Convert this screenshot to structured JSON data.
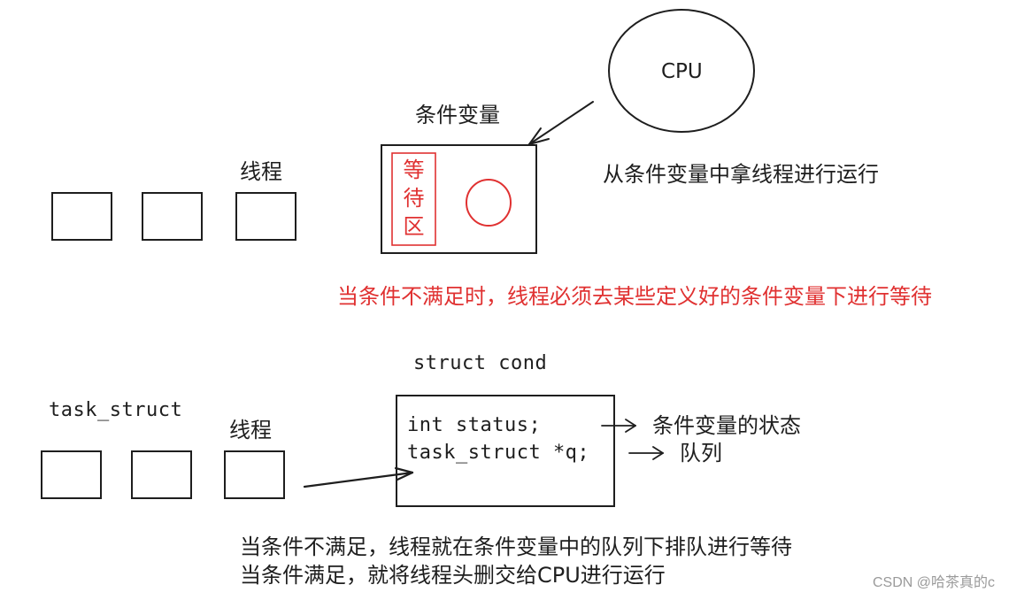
{
  "colors": {
    "ink": "#1e1e1e",
    "accent_red": "#e03131",
    "watermark": "#9a9a9a",
    "background": "#ffffff"
  },
  "top_section": {
    "cpu_label": "CPU",
    "cond_var_title": "条件变量",
    "threads_label": "线程",
    "wait_area_chars": [
      "等",
      "待",
      "区"
    ],
    "cpu_note": "从条件变量中拿线程进行运行",
    "red_note": "当条件不满足时，线程必须去某些定义好的条件变量下进行等待",
    "thread_box_count": 3
  },
  "bottom_section": {
    "struct_title": "struct cond",
    "task_struct_label": "task_struct",
    "threads_label": "线程",
    "fields": [
      {
        "code": "int status;",
        "note": "条件变量的状态"
      },
      {
        "code": "task_struct *q;",
        "note": "队列"
      }
    ],
    "thread_box_count": 3,
    "notes": [
      "当条件不满足，线程就在条件变量中的队列下排队进行等待",
      "当条件满足，就将线程头删交给CPU进行运行"
    ]
  },
  "watermark": "CSDN @哈茶真的c"
}
